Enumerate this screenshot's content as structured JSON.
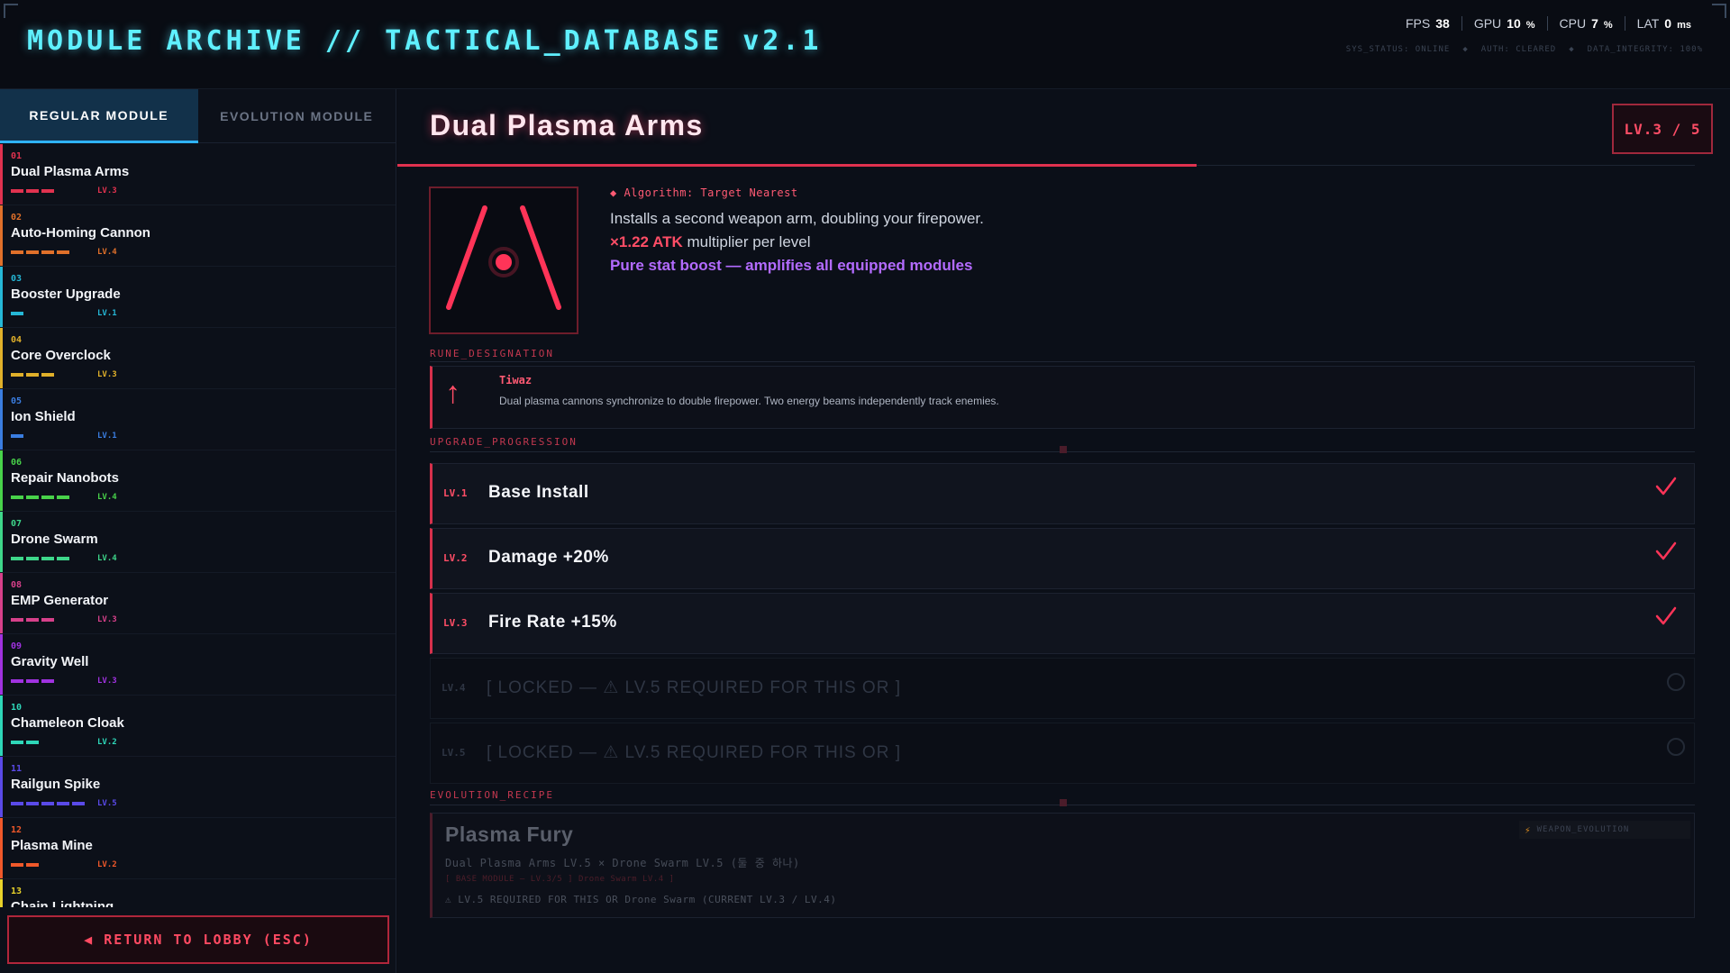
{
  "header": {
    "title": "MODULE ARCHIVE  //  TACTICAL_DATABASE v2.1",
    "stats": [
      {
        "label": "FPS",
        "value": "38",
        "unit": ""
      },
      {
        "label": "GPU",
        "value": "10",
        "unit": "%"
      },
      {
        "label": "CPU",
        "value": "7",
        "unit": "%"
      },
      {
        "label": "LAT",
        "value": "0",
        "unit": "ms"
      }
    ],
    "sys_status": "SYS_STATUS: ONLINE",
    "auth": "AUTH: CLEARED",
    "integrity": "DATA_INTEGRITY: 100%",
    "separator": "◆"
  },
  "tabs": {
    "regular": "REGULAR MODULE",
    "evolution": "EVOLUTION MODULE"
  },
  "modules": [
    {
      "num": "01",
      "name": "Dual Plasma Arms",
      "level": "LV.3",
      "level_value": 3,
      "color": "#e0324f"
    },
    {
      "num": "02",
      "name": "Auto-Homing Cannon",
      "level": "LV.4",
      "level_value": 4,
      "color": "#e0702a"
    },
    {
      "num": "03",
      "name": "Booster Upgrade",
      "level": "LV.1",
      "level_value": 1,
      "color": "#25b7d6"
    },
    {
      "num": "04",
      "name": "Core Overclock",
      "level": "LV.3",
      "level_value": 3,
      "color": "#e0b02a"
    },
    {
      "num": "05",
      "name": "Ion Shield",
      "level": "LV.1",
      "level_value": 1,
      "color": "#3a7de0"
    },
    {
      "num": "06",
      "name": "Repair Nanobots",
      "level": "LV.4",
      "level_value": 4,
      "color": "#48d24a"
    },
    {
      "num": "07",
      "name": "Drone Swarm",
      "level": "LV.4",
      "level_value": 4,
      "color": "#3ed68a"
    },
    {
      "num": "08",
      "name": "EMP Generator",
      "level": "LV.3",
      "level_value": 3,
      "color": "#d6408a"
    },
    {
      "num": "09",
      "name": "Gravity Well",
      "level": "LV.3",
      "level_value": 3,
      "color": "#a032e0"
    },
    {
      "num": "10",
      "name": "Chameleon Cloak",
      "level": "LV.2",
      "level_value": 2,
      "color": "#2ed6b8"
    },
    {
      "num": "11",
      "name": "Railgun Spike",
      "level": "LV.5",
      "level_value": 5,
      "color": "#5a4ae8"
    },
    {
      "num": "12",
      "name": "Plasma Mine",
      "level": "LV.2",
      "level_value": 2,
      "color": "#f0582a"
    },
    {
      "num": "13",
      "name": "Chain Lightning",
      "level": "",
      "level_value": 0,
      "color": "#e8d22a"
    }
  ],
  "lobby_button": "◀  RETURN TO LOBBY  (ESC)",
  "detail": {
    "title": "Dual Plasma Arms",
    "level_badge": "LV.3 / 5",
    "algorithm": "◆ Algorithm: Target Nearest",
    "description": "Installs a second weapon arm, doubling your firepower.",
    "multiplier_value": "×1.22 ATK",
    "multiplier_suffix": " multiplier per level",
    "boost": "Pure stat boost — amplifies all equipped modules",
    "rune_label": "RUNE_DESIGNATION",
    "rune_glyph": "↑",
    "rune_name": "Tiwaz",
    "rune_description": "Dual plasma cannons synchronize to double firepower. Two energy beams independently track enemies.",
    "upgrade_label": "UPGRADE_PROGRESSION",
    "levels": [
      {
        "tag": "LV.1",
        "text": "Base Install",
        "state": "done"
      },
      {
        "tag": "LV.2",
        "text": "Damage +20%",
        "state": "done"
      },
      {
        "tag": "LV.3",
        "text": "Fire Rate +15%",
        "state": "done"
      },
      {
        "tag": "LV.4",
        "text": "[ LOCKED — ⚠ LV.5 REQUIRED FOR THIS OR ]",
        "state": "locked"
      },
      {
        "tag": "LV.5",
        "text": "[ LOCKED — ⚠ LV.5 REQUIRED FOR THIS OR ]",
        "state": "locked"
      }
    ],
    "evolution_label": "EVOLUTION_RECIPE",
    "evolution": {
      "name": "Plasma Fury",
      "badge": "WEAPON_EVOLUTION",
      "recipe": "Dual Plasma Arms  LV.5  ×  Drone Swarm  LV.5  (둘 중 하나)",
      "current": "[ BASE MODULE — LV.3/5 ]   Drone Swarm LV.4 ]",
      "requirement": "⚠  LV.5 REQUIRED FOR THIS OR Drone Swarm (CURRENT LV.3 / LV.4)"
    }
  }
}
